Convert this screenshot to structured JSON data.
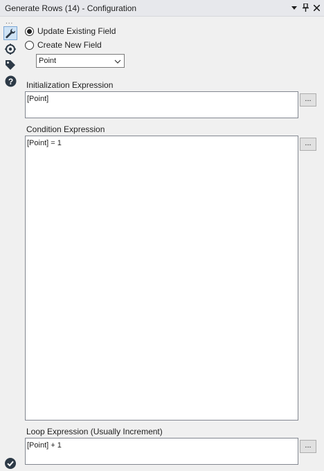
{
  "titlebar": {
    "title": "Generate Rows (14) - Configuration"
  },
  "sidebar": {
    "overflow": "...",
    "icons": [
      "wrench-icon",
      "target-icon",
      "tag-icon",
      "help-icon"
    ]
  },
  "options": {
    "update_existing_label": "Update Existing Field",
    "create_new_label": "Create New  Field",
    "selected": "update_existing",
    "field_select_value": "Point"
  },
  "init_expr": {
    "label": "Initialization Expression",
    "value": "[Point]",
    "button": "..."
  },
  "cond_expr": {
    "label": "Condition Expression",
    "value": "[Point] = 1",
    "button": "..."
  },
  "loop_expr": {
    "label": "Loop Expression (Usually Increment)",
    "value": "[Point] + 1",
    "button": "..."
  },
  "colors": {
    "titlebar": "#e7e8ec",
    "panel": "#f0f0f0",
    "active_icon_bg": "#cfe3f5",
    "icon_dark": "#2d3a47"
  }
}
